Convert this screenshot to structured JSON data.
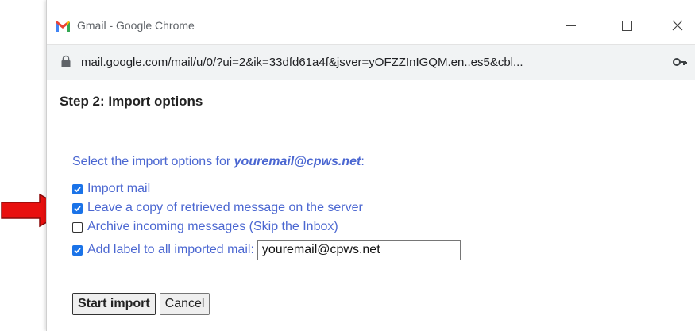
{
  "window": {
    "title": "Gmail - Google Chrome",
    "url": "mail.google.com/mail/u/0/?ui=2&ik=33dfd61a4f&jsver=yOFZZInIGQM.en..es5&cbl..."
  },
  "dialog": {
    "step_title": "Step 2: Import options",
    "prompt_prefix": "Select the import options for ",
    "email": "youremail@cpws.net",
    "prompt_suffix": ":",
    "options": [
      {
        "label": "Import mail",
        "checked": true
      },
      {
        "label": "Leave a copy of retrieved message on the server",
        "checked": true
      },
      {
        "label": "Archive incoming messages (Skip the Inbox)",
        "checked": false
      },
      {
        "label": "Add label to all imported mail:",
        "checked": true
      }
    ],
    "label_value": "youremail@cpws.net",
    "start_button": "Start import",
    "cancel_button": "Cancel"
  },
  "colors": {
    "accent": "#4b67d1",
    "checkbox": "#1a73e8",
    "arrow": "#e8100f"
  }
}
